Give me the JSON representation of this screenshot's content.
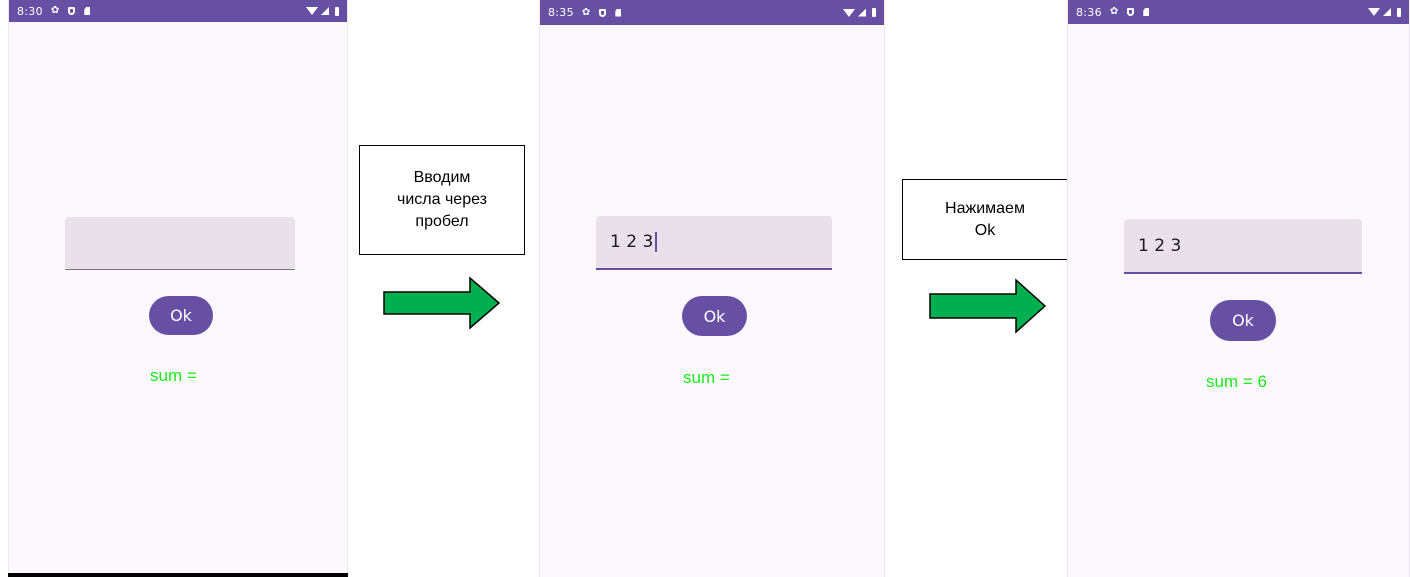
{
  "screens": [
    {
      "status_time": "8:30",
      "input_value": "",
      "ok_label": "Ok",
      "result_text": "sum ="
    },
    {
      "status_time": "8:35",
      "input_value": "1 2 3",
      "ok_label": "Ok",
      "result_text": "sum ="
    },
    {
      "status_time": "8:36",
      "input_value": "1 2 3",
      "ok_label": "Ok",
      "result_text": "sum = 6"
    }
  ],
  "annotations": [
    {
      "lines": [
        "Вводим",
        "числа через",
        "пробел"
      ]
    },
    {
      "lines": [
        "Нажимаем",
        "Ok"
      ]
    }
  ],
  "colors": {
    "primary": "#6750a4",
    "screen_bg": "#fdf7fe",
    "input_bg": "#e8e0eb",
    "result_text": "#1aeb1a",
    "arrow_fill": "#00b050"
  },
  "icons": [
    "settings-icon",
    "shield-icon",
    "sd-card-icon",
    "wifi-icon",
    "cell-signal-icon",
    "battery-icon",
    "right-arrow-icon"
  ]
}
